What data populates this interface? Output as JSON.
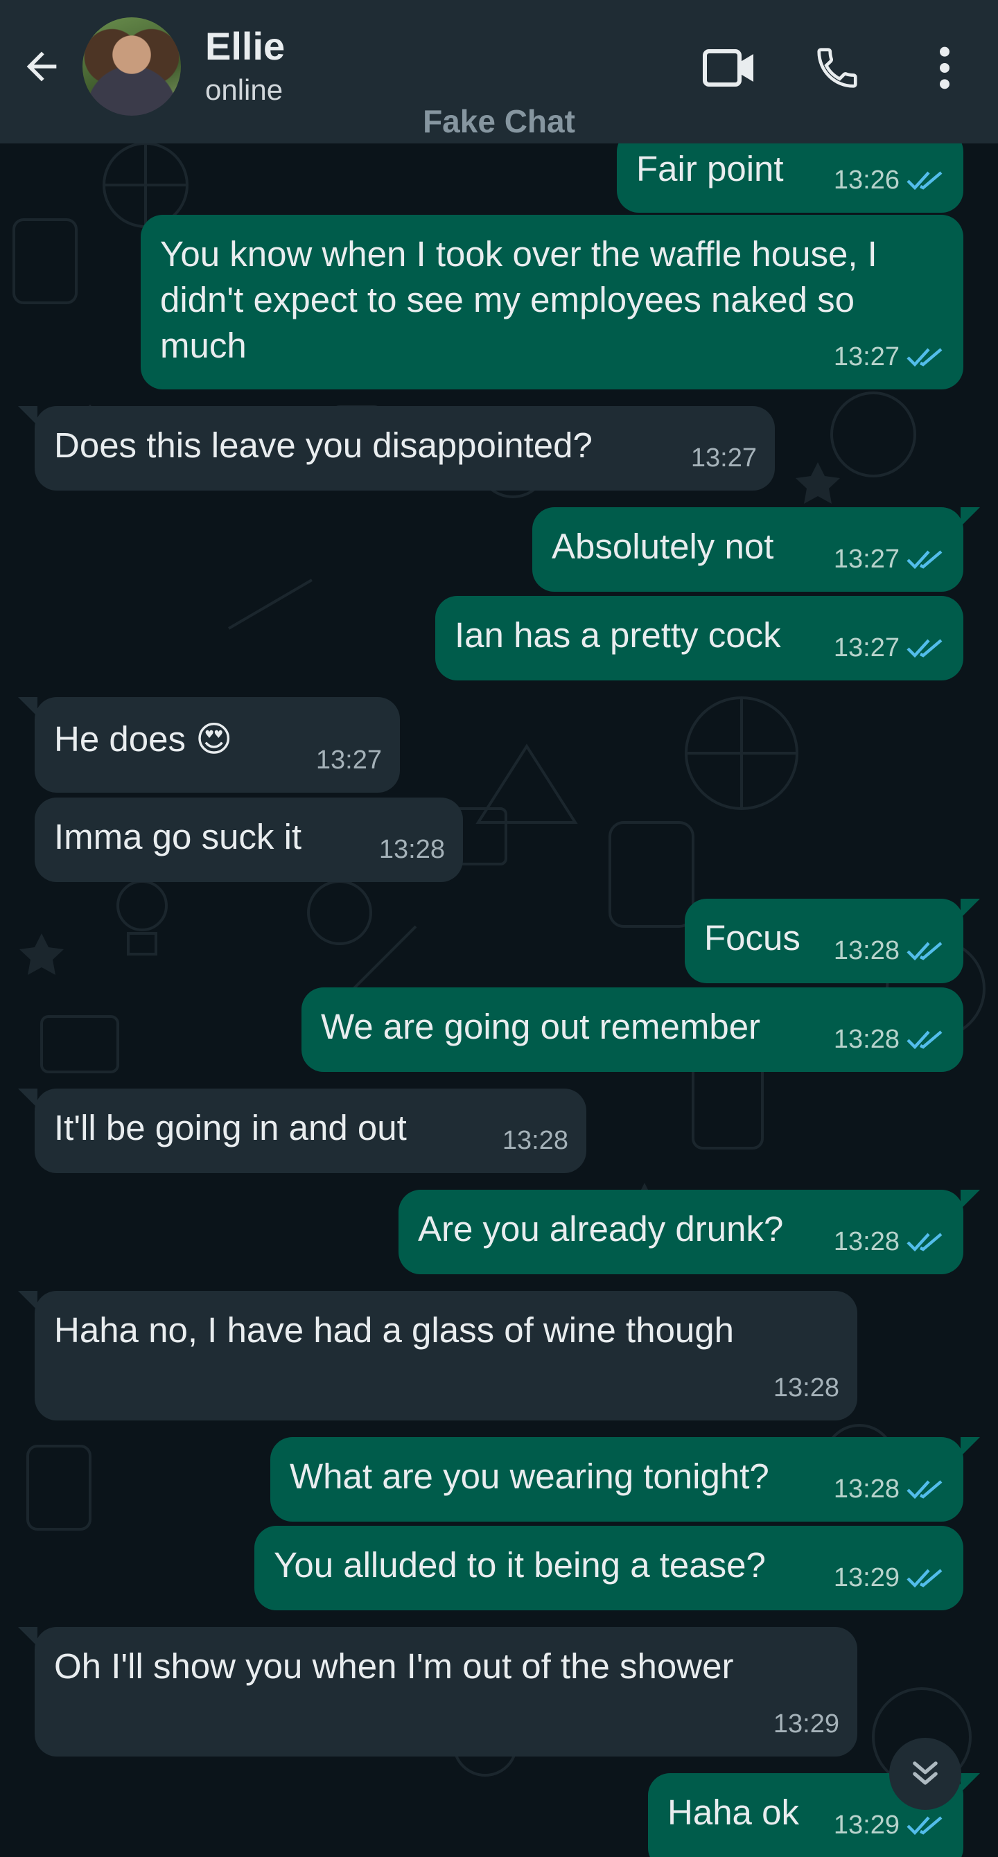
{
  "header": {
    "contact_name": "Ellie",
    "contact_status": "online",
    "watermark": "Fake Chat"
  },
  "icons": {
    "back": "arrow-left-icon",
    "video": "video-camera-icon",
    "call": "phone-icon",
    "menu": "more-vertical-icon",
    "read_receipt": "double-check-icon",
    "scroll_down": "chevron-double-down-icon"
  },
  "colors": {
    "outgoing_bubble": "#005c4b",
    "incoming_bubble": "#1f2c34",
    "read_tick": "#53bdeb",
    "background": "#0b141a"
  },
  "messages": [
    {
      "dir": "out",
      "text": "Fair point",
      "time": "13:26"
    },
    {
      "dir": "out",
      "text": "You know when I took over the waffle house, I didn't expect to see my employees naked so much",
      "time": "13:27"
    },
    {
      "dir": "in",
      "text": "Does this leave you disappointed?",
      "time": "13:27"
    },
    {
      "dir": "out",
      "text": "Absolutely not",
      "time": "13:27"
    },
    {
      "dir": "out",
      "text": "Ian has a pretty cock",
      "time": "13:27"
    },
    {
      "dir": "in",
      "text": "He does 😍",
      "time": "13:27"
    },
    {
      "dir": "in",
      "text": "Imma go suck it",
      "time": "13:28"
    },
    {
      "dir": "out",
      "text": "Focus",
      "time": "13:28"
    },
    {
      "dir": "out",
      "text": "We are going out remember",
      "time": "13:28"
    },
    {
      "dir": "in",
      "text": "It'll be going in and out",
      "time": "13:28"
    },
    {
      "dir": "out",
      "text": "Are you already drunk?",
      "time": "13:28"
    },
    {
      "dir": "in",
      "text": "Haha no, I have had a glass of wine though",
      "time": "13:28"
    },
    {
      "dir": "out",
      "text": "What are you wearing tonight?",
      "time": "13:28"
    },
    {
      "dir": "out",
      "text": "You alluded to it being a tease?",
      "time": "13:29"
    },
    {
      "dir": "in",
      "text": "Oh I'll show you when I'm out of the shower",
      "time": "13:29"
    },
    {
      "dir": "out",
      "text": "Haha ok",
      "time": "13:29"
    }
  ]
}
